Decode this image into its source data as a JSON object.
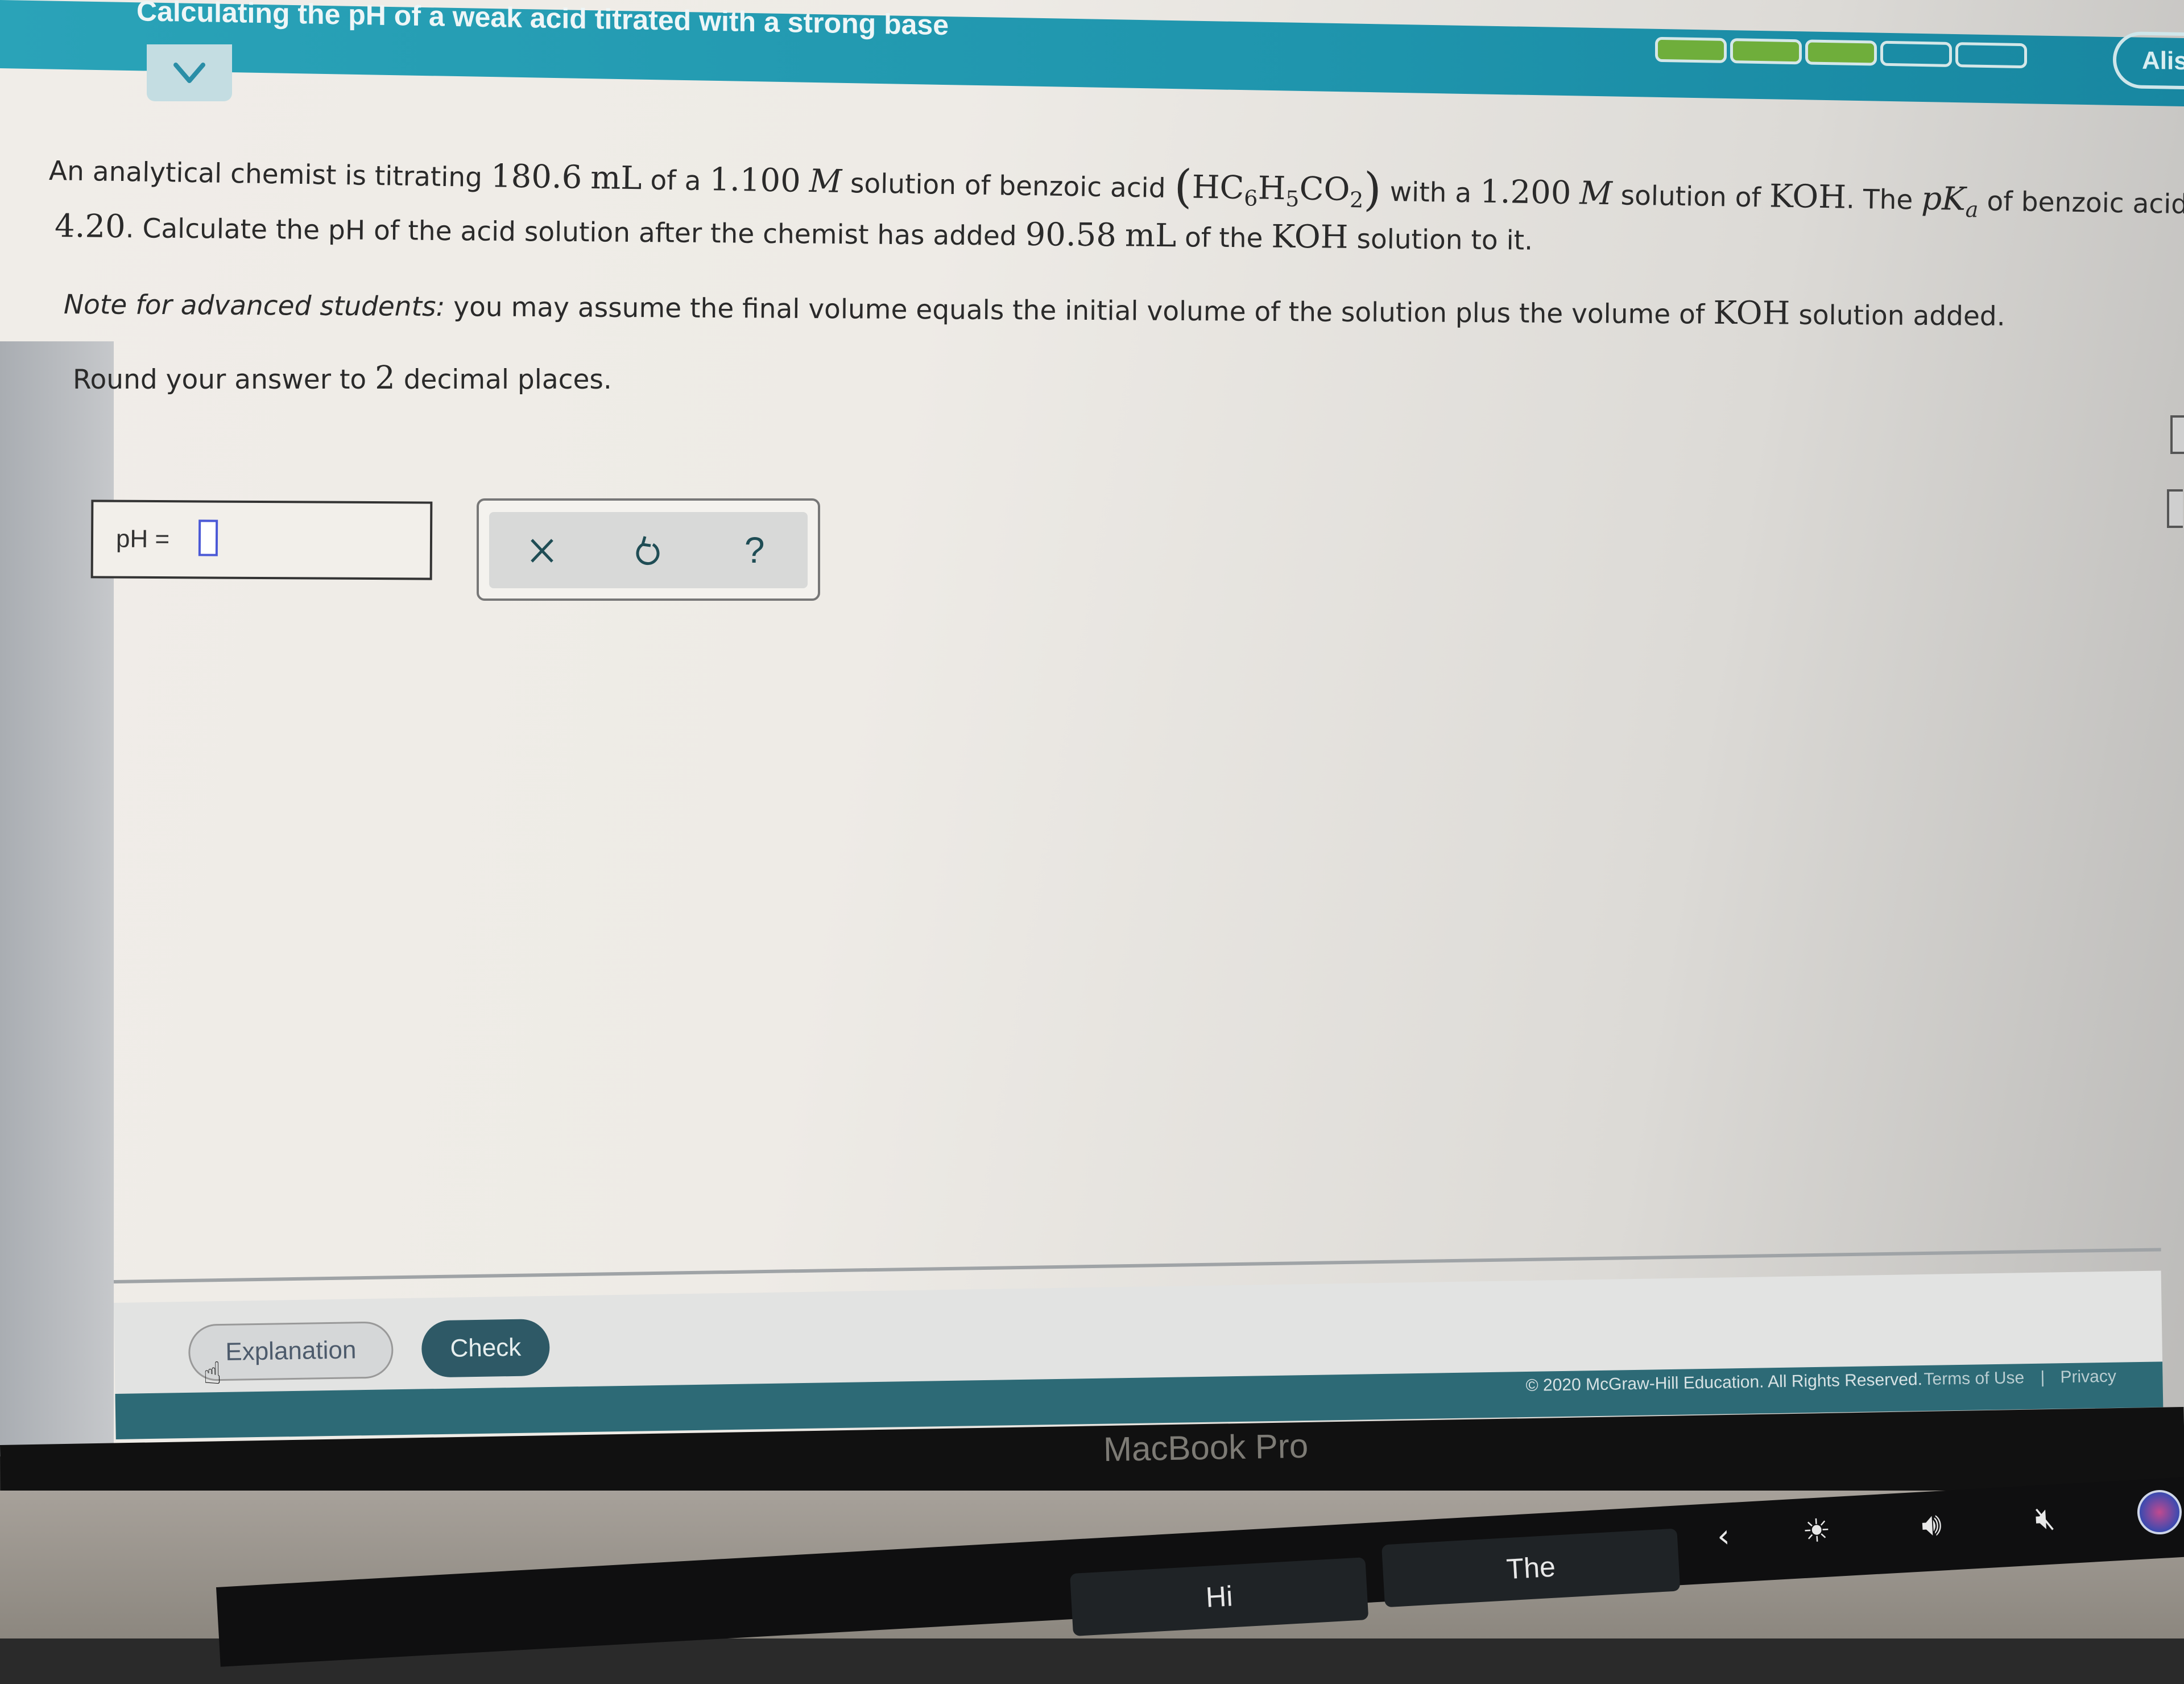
{
  "header": {
    "title": "Calculating the pH of a weak acid titrated with a strong base",
    "progress": {
      "filled": 3,
      "total": 5
    },
    "user_name_partial": "Alis"
  },
  "colors": {
    "header_teal": "#1f95ad",
    "progress_green": "#6fae3b",
    "check_button": "#2e5966",
    "input_border": "#4b59d6",
    "footer_teal": "#2d6a76"
  },
  "question": {
    "line1_part1": "An analytical chemist is titrating",
    "acid_volume": "180.6",
    "unit_ml": "mL",
    "line1_part2": "of a",
    "acid_molarity": "1.100",
    "molar_symbol": "M",
    "line1_part3": "solution of benzoic acid",
    "formula_parts": [
      "HC",
      "6",
      "H",
      "5",
      "CO",
      "2"
    ],
    "line1_part4": "with a",
    "base_molarity": "1.200",
    "line1_part5": "solution of",
    "base_name": "KOH",
    "line1_part6": ". The",
    "pka_p": "p",
    "pka_K": "K",
    "pka_sub": "a",
    "line1_part7": "of benzoic acid is",
    "pka_value": "4.20",
    "line2_part1": ". Calculate the pH of the acid solution after the chemist has added",
    "base_volume": "90.58",
    "line2_part2": "of the",
    "line2_part3": "solution to it.",
    "note_label": "Note for advanced students:",
    "note_text_1": "you may assume the final volume equals the initial volume of the solution plus the volume of",
    "note_text_2": "solution added.",
    "round_text_1": "Round your answer to",
    "round_digits": "2",
    "round_text_2": "decimal places."
  },
  "answer": {
    "label": "pH =",
    "value": "",
    "placeholder": ""
  },
  "tools": {
    "clear_label": "×",
    "undo_label": "undo",
    "help_label": "?"
  },
  "footer": {
    "explanation_label": "Explanation",
    "check_label": "Check",
    "copyright": "© 2020 McGraw-Hill Education. All Rights Reserved.",
    "terms_label": "Terms of Use",
    "separator": "|",
    "privacy_label": "Privacy"
  },
  "device": {
    "bezel_label": "MacBook Pro",
    "touchbar_suggestions": [
      "Hi",
      "The"
    ]
  }
}
